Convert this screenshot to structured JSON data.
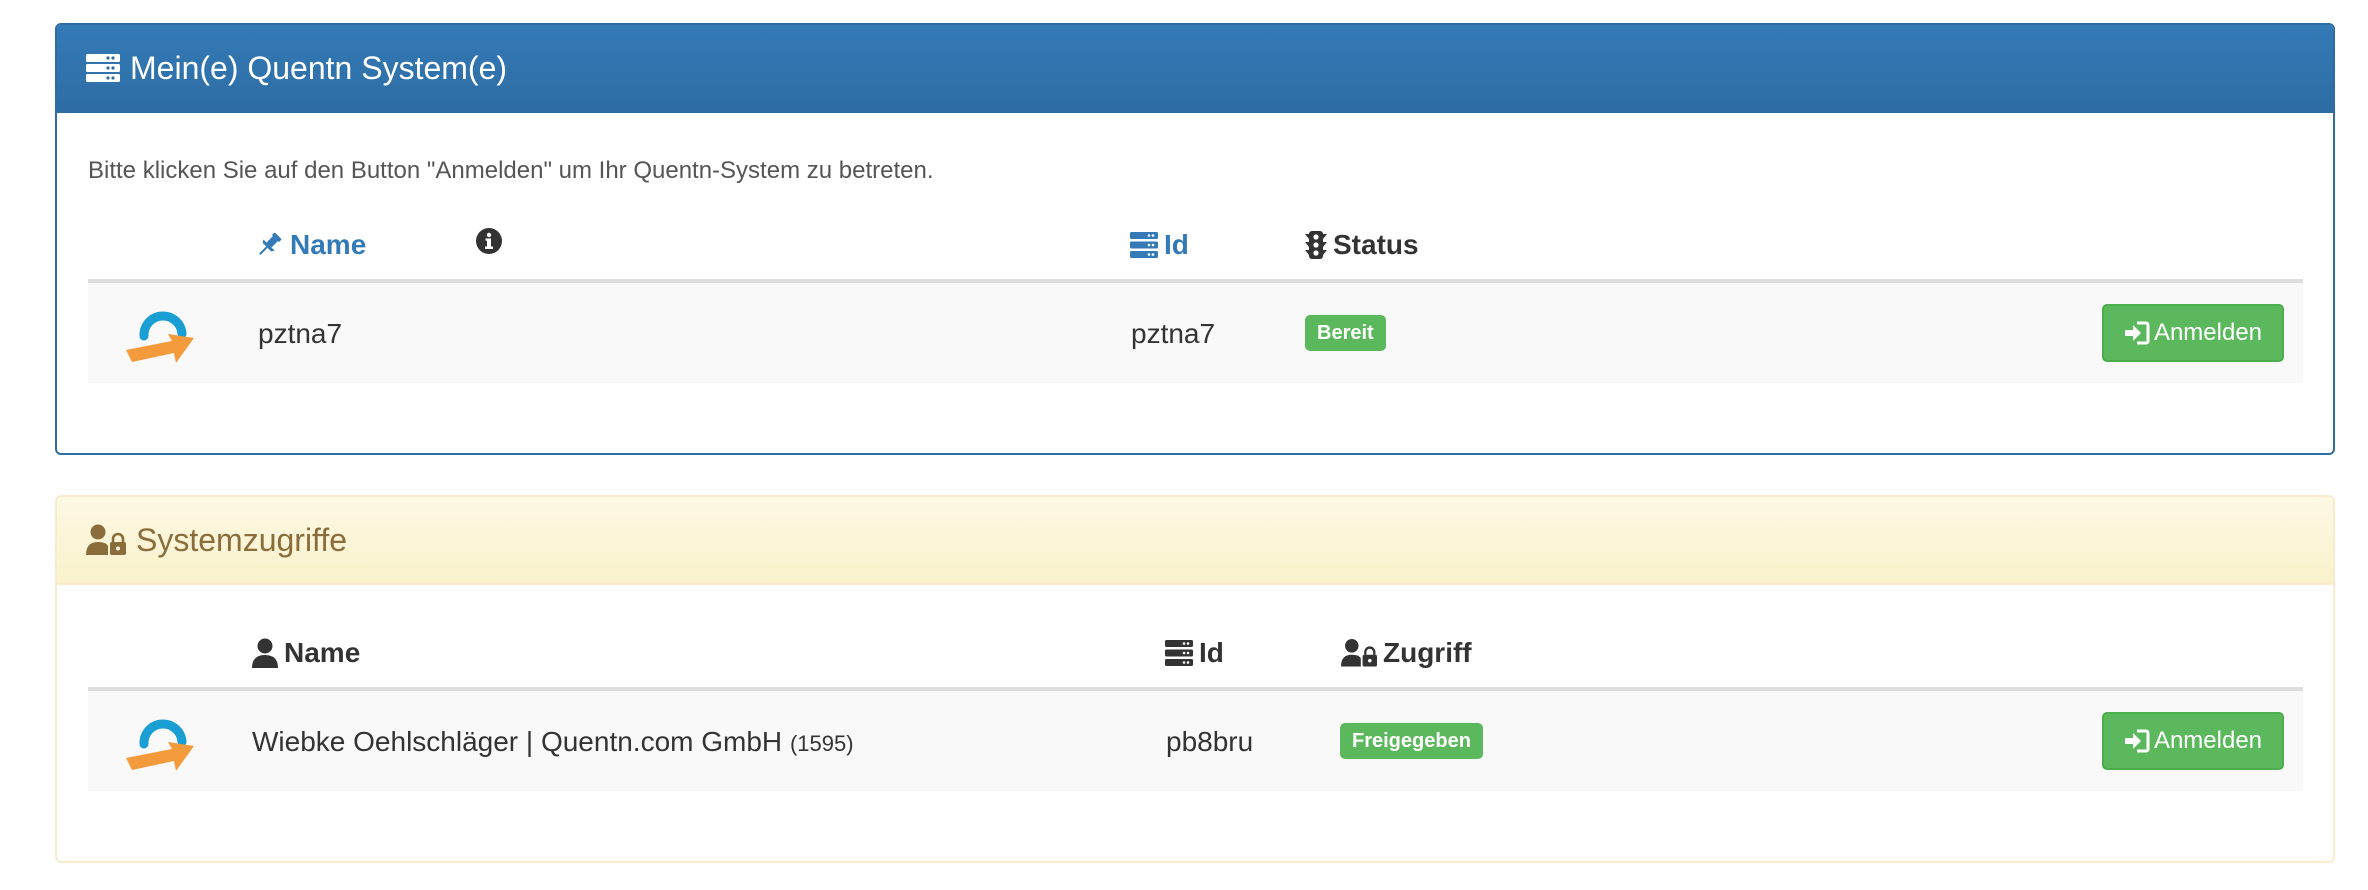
{
  "systems_panel": {
    "title": "Mein(e) Quentn System(e)",
    "intro": "Bitte klicken Sie auf den Button \"Anmelden\" um Ihr Quentn-System zu betreten.",
    "columns": {
      "name": "Name",
      "id": "Id",
      "status": "Status"
    },
    "rows": [
      {
        "name": "pztna7",
        "id": "pztna7",
        "status": "Bereit",
        "action": "Anmelden"
      }
    ]
  },
  "access_panel": {
    "title": "Systemzugriffe",
    "columns": {
      "name": "Name",
      "id": "Id",
      "access": "Zugriff"
    },
    "rows": [
      {
        "name": "Wiebke Oehlschläger | Quentn.com GmbH",
        "user_id": "(1595)",
        "id": "pb8bru",
        "access": "Freigegeben",
        "action": "Anmelden"
      }
    ]
  },
  "colors": {
    "primary": "#337ab7",
    "warning_bg": "#fcf8e3",
    "warning_text": "#8a6d3b",
    "success": "#5cb85c",
    "logo_blue": "#1a9fd4",
    "logo_orange": "#f39a3c"
  },
  "icons": {
    "systems_header": "server-icon",
    "access_header": "user-lock-icon",
    "name_col": "thumbtack-icon",
    "info": "info-circle-icon",
    "id_col": "server-icon",
    "status_col": "traffic-light-icon",
    "user_col": "user-icon",
    "login": "sign-in-icon",
    "logo": "quentn-logo"
  }
}
